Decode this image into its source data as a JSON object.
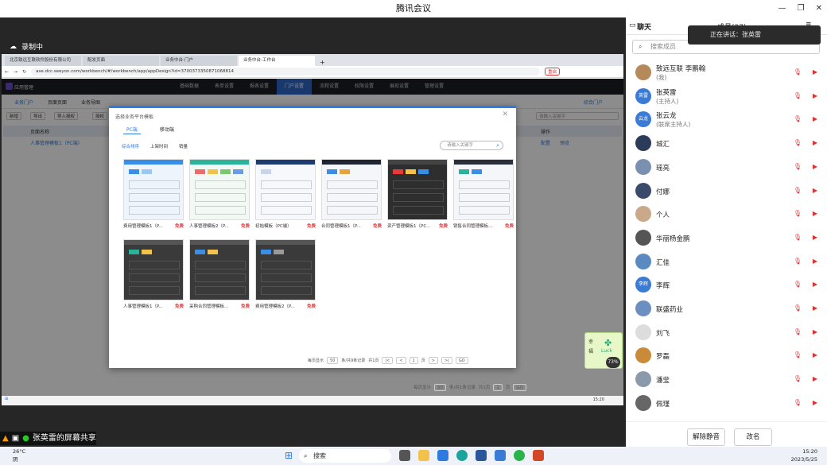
{
  "meeting": {
    "title": "腾讯会议",
    "recording": "录制中",
    "sharing_label": "张英雷的屏幕共享"
  },
  "browser": {
    "tabs": [
      "北京致远互联软件股份有限公司",
      "配发页面",
      "业务中台-门户",
      "业务中台-工作台"
    ],
    "url": "ase.dcc.seeyon.com/workbench/#/workbench/app/appDesign?id=3700373350871068814",
    "restart": "重启"
  },
  "app": {
    "name": "应用管理",
    "nav": [
      "基础数据",
      "表单设置",
      "报表设置",
      "门户设置",
      "流程设置",
      "权限设置",
      "展现设置",
      "管理设置"
    ],
    "active_nav": "门户设置",
    "subtabs": [
      "业务门户",
      "页面页面",
      "业务导图"
    ],
    "toolbar": [
      "新增",
      "导出",
      "导入授权",
      "授权"
    ],
    "list_header": "页面名称",
    "list_col_action": "操作",
    "list_row": "人事管理模板1（PC端）",
    "row_actions": [
      "配置",
      "预览"
    ],
    "portal_link": "综合门户",
    "search_placeholder": "请输入关键字",
    "pager": {
      "per_page": "每页显示",
      "size": "50",
      "total": "条/共1条记录",
      "total_pages": "共1页",
      "page": "1",
      "page_label": "页",
      "go": "GO"
    }
  },
  "modal": {
    "title": "选择业务平台模板",
    "tabs": [
      "PC端",
      "移动端"
    ],
    "filters": [
      "综合排序",
      "上架时间",
      "销量"
    ],
    "search_placeholder": "请输入关键字",
    "cards": [
      {
        "name": "费用管理模板1（P...",
        "badge": "免费",
        "theme": "light-blue"
      },
      {
        "name": "人事管理模板2（P...",
        "badge": "免费",
        "theme": "light-green"
      },
      {
        "name": "初始模板（PC端）",
        "badge": "免费",
        "theme": "light-plain"
      },
      {
        "name": "合同管理模板1（P...",
        "badge": "免费",
        "theme": "dark-sidebar"
      },
      {
        "name": "资产管理模板1（PC...",
        "badge": "免费",
        "theme": "dark-red"
      },
      {
        "name": "销售合同管理模板...",
        "badge": "免费",
        "theme": "light-sidebar"
      },
      {
        "name": "人事管理模板1（P...",
        "badge": "免费",
        "theme": "dark-grid"
      },
      {
        "name": "采购合同管理模板...",
        "badge": "免费",
        "theme": "dark-donut"
      },
      {
        "name": "费用管理模板2（P...",
        "badge": "免费",
        "theme": "dark-grid2"
      }
    ],
    "pager": {
      "per_page": "每页显示",
      "size": "50",
      "total": "条/共9条记录",
      "total_pages": "共1页",
      "page": "1",
      "page_label": "页",
      "go": "GO"
    }
  },
  "luck": {
    "text": "Luck",
    "percent": "73%",
    "line1": "幸",
    "line2": "福"
  },
  "panel": {
    "tabs": {
      "chat": "聊天",
      "members": "成员(27)"
    },
    "search_placeholder": "搜索成员",
    "speaking": "正在讲话：张英雷",
    "members": [
      {
        "name": "致远互联 李鹏翰",
        "role": "(我)",
        "avatar": "#b48a5a",
        "text": ""
      },
      {
        "name": "张英雷",
        "role": "(主持人)",
        "avatar": "#3a7bd5",
        "text": "英雷"
      },
      {
        "name": "张云龙",
        "role": "(联席主持人)",
        "avatar": "#3a7bd5",
        "text": "云龙"
      },
      {
        "name": "城汇",
        "role": "",
        "avatar": "#2a3c5a",
        "text": ""
      },
      {
        "name": "瑶亮",
        "role": "",
        "avatar": "#7a90b0",
        "text": ""
      },
      {
        "name": "付娜",
        "role": "",
        "avatar": "#3a4a6a",
        "text": ""
      },
      {
        "name": "个人",
        "role": "",
        "avatar": "#caa98a",
        "text": ""
      },
      {
        "name": "华丽杨金鹏",
        "role": "",
        "avatar": "#555",
        "text": ""
      },
      {
        "name": "汇佳",
        "role": "",
        "avatar": "#5a8ac0",
        "text": ""
      },
      {
        "name": "李辉",
        "role": "",
        "avatar": "#3a7bd5",
        "text": "李辉"
      },
      {
        "name": "联盛药业",
        "role": "",
        "avatar": "#6a8fc0",
        "text": ""
      },
      {
        "name": "刘飞",
        "role": "",
        "avatar": "#ddd",
        "text": ""
      },
      {
        "name": "罗磊",
        "role": "",
        "avatar": "#c98a3a",
        "text": ""
      },
      {
        "name": "潘莹",
        "role": "",
        "avatar": "#8a9aaa",
        "text": ""
      },
      {
        "name": "佩瑾",
        "role": "",
        "avatar": "#666",
        "text": ""
      }
    ],
    "buttons": {
      "unmute": "解除静音",
      "rename": "改名"
    }
  },
  "taskbar": {
    "weather_temp": "26°C",
    "weather_desc": "阴",
    "search": "搜索",
    "time": "15:20",
    "date": "2023/5/25",
    "share_time": "15:20"
  }
}
